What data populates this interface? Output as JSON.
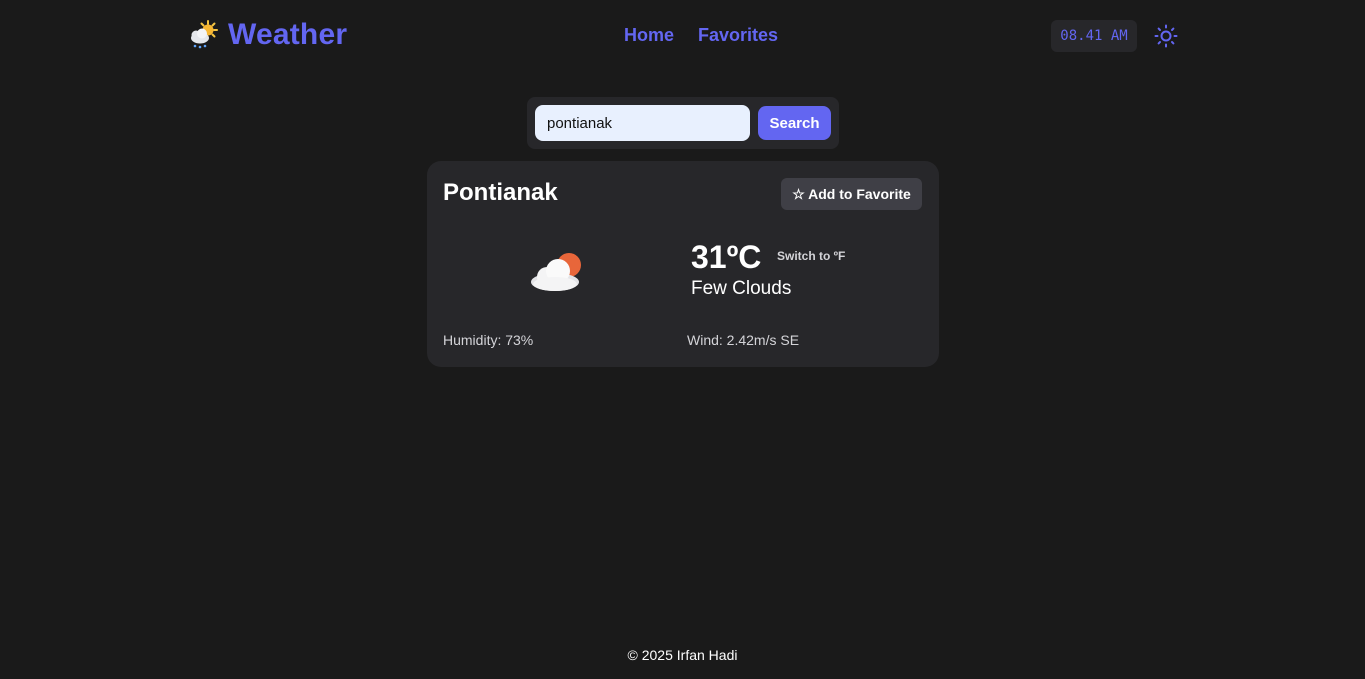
{
  "header": {
    "brand_icon": "sun-behind-rain-cloud-icon",
    "title": "Weather",
    "nav": [
      {
        "label": "Home"
      },
      {
        "label": "Favorites"
      }
    ],
    "clock": "08.41 AM",
    "theme_toggle_icon": "sun-icon"
  },
  "search": {
    "value": "pontianak",
    "button_label": "Search"
  },
  "weather": {
    "city": "Pontianak",
    "favorite_label": "☆ Add to Favorite",
    "icon": "few-clouds-icon",
    "temperature": "31ºC",
    "switch_label": "Switch to ºF",
    "condition": "Few Clouds",
    "humidity": "Humidity: 73%",
    "wind": "Wind: 2.42m/s SE"
  },
  "footer": {
    "text": "© 2025 Irfan Hadi"
  },
  "colors": {
    "accent": "#6366f1",
    "background": "#1a1a1a",
    "card": "#27272a"
  }
}
